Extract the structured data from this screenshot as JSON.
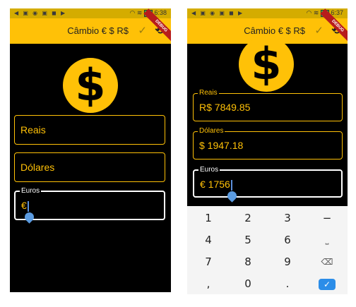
{
  "status": {
    "left_icons": "◀ ▣ ◉ ▣ ◼ ▶",
    "signal": "≋",
    "time_left": "6:38",
    "time_right": "6:37"
  },
  "appbar": {
    "title": "Câmbio € $  R$",
    "check_icon": "✓",
    "refresh_icon": "⟲",
    "debug_label": "DEBUG"
  },
  "coin_symbol": "$",
  "left_form": {
    "reais_hint": "Reais",
    "dolares_hint": "Dólares",
    "euros_label": "Euros",
    "euros_prefix": "€"
  },
  "right_form": {
    "reais_label": "Reais",
    "reais_value": "R$ 7849.85",
    "dolares_label": "Dólares",
    "dolares_value": "$ 1947.18",
    "euros_label": "Euros",
    "euros_value": "€ 1756"
  },
  "keyboard": {
    "rows": [
      [
        "1",
        "2",
        "3",
        "−"
      ],
      [
        "4",
        "5",
        "6",
        "⎵"
      ],
      [
        "7",
        "8",
        "9",
        "⌫"
      ],
      [
        ",",
        "0",
        ".",
        "✓"
      ]
    ]
  },
  "colors": {
    "accent": "#ffc107",
    "background": "#000000",
    "focus": "#ffffff",
    "cursor": "#5b9be0"
  }
}
